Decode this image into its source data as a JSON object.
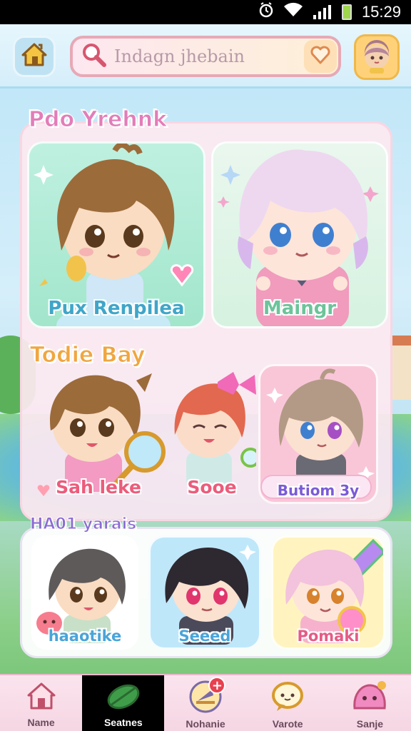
{
  "status_bar": {
    "time": "15:29",
    "icons": [
      "alarm-icon",
      "wifi-icon",
      "signal-icon",
      "battery-icon"
    ]
  },
  "header": {
    "home_icon": "home-icon",
    "search": {
      "value": "Indagn jhebain",
      "icon": "search-icon",
      "favorite_icon": "heart-icon"
    },
    "profile_icon": "avatar-icon"
  },
  "sections": [
    {
      "title": "Pdo Yrehnk",
      "cards": [
        {
          "label": "Pux Renpilea"
        },
        {
          "label": "Maingr"
        }
      ]
    },
    {
      "title": "Todie Bay",
      "cards": [
        {
          "label": "Sah leke"
        },
        {
          "label": "Sooe"
        },
        {
          "label": "Butiom 3y"
        }
      ]
    },
    {
      "title": "HA01 yarais",
      "cards": [
        {
          "label": "haaotike"
        },
        {
          "label": "Seeed"
        },
        {
          "label": "Pomaki"
        }
      ]
    }
  ],
  "bottom_nav": {
    "items": [
      {
        "label": "Name",
        "icon": "house-icon",
        "active": false
      },
      {
        "label": "Seatnes",
        "icon": "leaf-icon",
        "active": true
      },
      {
        "label": "Nohanie",
        "icon": "lantern-icon",
        "active": false,
        "badge": "+"
      },
      {
        "label": "Varote",
        "icon": "chat-bubble-icon",
        "active": false
      },
      {
        "label": "Sanje",
        "icon": "slime-icon",
        "active": false
      }
    ]
  },
  "colors": {
    "accent_pink": "#e37db9",
    "accent_orange": "#f0a640",
    "accent_purple": "#8c6bd3",
    "nav_active": "#000000"
  }
}
